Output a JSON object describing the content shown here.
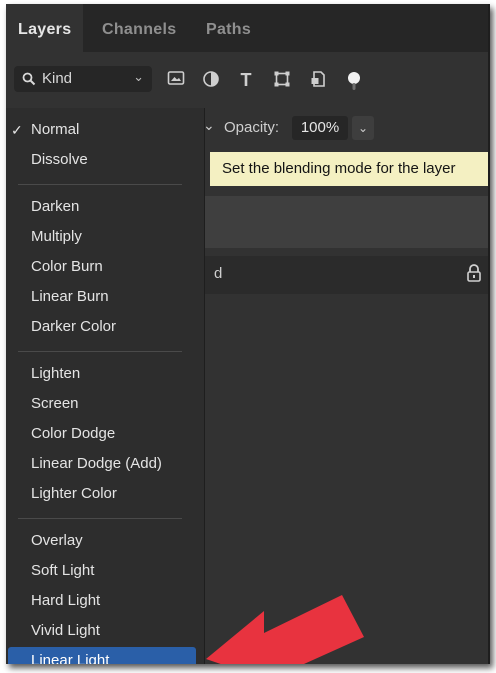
{
  "tabs": [
    "Layers",
    "Channels",
    "Paths"
  ],
  "filter": {
    "kind_label": "Kind",
    "icons": [
      "image-filter-icon",
      "adjustment-filter-icon",
      "type-filter-icon",
      "shape-filter-icon",
      "smart-object-filter-icon",
      "filter-toggle-icon"
    ]
  },
  "opacity": {
    "label": "Opacity:",
    "value": "100%"
  },
  "tooltip": "Set the blending mode for the layer",
  "layer_name_fragment": "d",
  "blend_menu": {
    "selected": "Normal",
    "groups": [
      [
        "Normal",
        "Dissolve"
      ],
      [
        "Darken",
        "Multiply",
        "Color Burn",
        "Linear Burn",
        "Darker Color"
      ],
      [
        "Lighten",
        "Screen",
        "Color Dodge",
        "Linear Dodge (Add)",
        "Lighter Color"
      ],
      [
        "Overlay",
        "Soft Light",
        "Hard Light",
        "Vivid Light",
        "Linear Light"
      ]
    ],
    "highlighted": "Linear Light"
  },
  "colors": {
    "panel_bg": "#323232",
    "menu_bg": "#2d2d2d",
    "highlight": "#2a5fa8",
    "tooltip_bg": "#f4f0c2",
    "arrow": "#e8333f"
  }
}
